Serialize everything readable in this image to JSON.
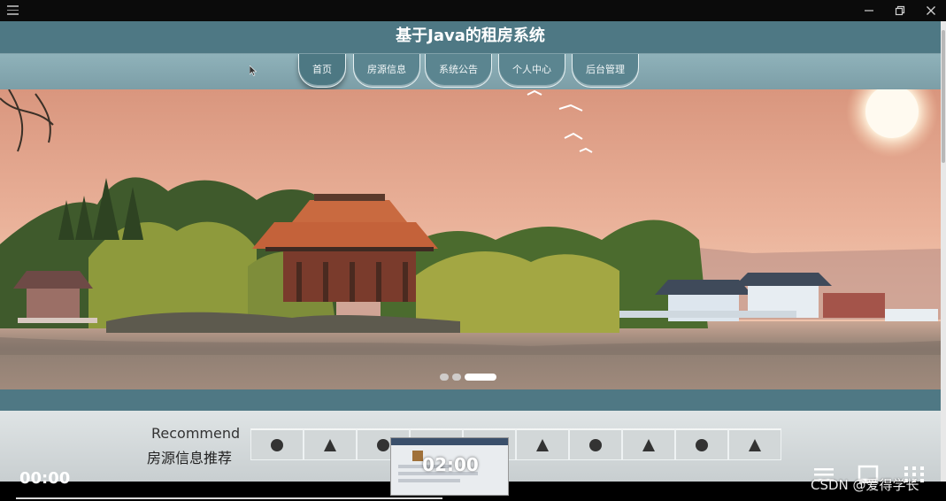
{
  "site": {
    "title": "基于Java的租房系统",
    "nav": [
      "首页",
      "房源信息",
      "系统公告",
      "个人中心",
      "后台管理"
    ],
    "active_nav": "首页",
    "banner_slides": 3,
    "banner_active_slide": 3,
    "recommend": {
      "heading_en": "Recommend",
      "heading_cn": "房源信息推荐",
      "tile_icons": [
        "circle-icon",
        "triangle-icon",
        "circle-icon",
        "triangle-icon",
        "circle-icon",
        "triangle-icon",
        "circle-icon",
        "triangle-icon",
        "circle-icon",
        "triangle-icon"
      ]
    }
  },
  "player": {
    "current_time": "00:00",
    "preview_time": "02:00",
    "watermark": "CSDN @爱得学长"
  },
  "colors": {
    "header": "#4e7884",
    "nav": "#5b8590",
    "band": "#4f7884"
  }
}
